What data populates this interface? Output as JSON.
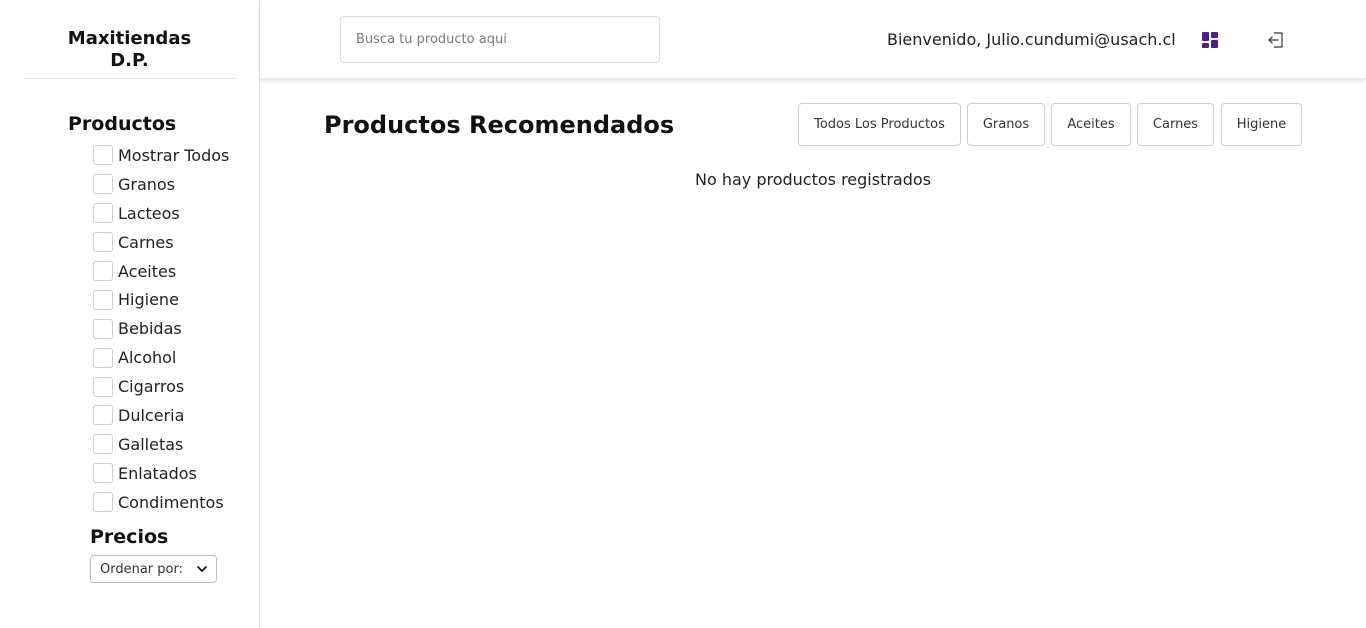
{
  "brand": {
    "line1": "Maxitiendas",
    "line2": "D.P."
  },
  "sidebar": {
    "categories_title": "Productos",
    "categories": [
      {
        "label": "Mostrar Todos",
        "checked": false
      },
      {
        "label": "Granos",
        "checked": false
      },
      {
        "label": "Lacteos",
        "checked": false
      },
      {
        "label": "Carnes",
        "checked": false
      },
      {
        "label": "Aceites",
        "checked": false
      },
      {
        "label": "Higiene",
        "checked": false
      },
      {
        "label": "Bebidas",
        "checked": false
      },
      {
        "label": "Alcohol",
        "checked": false
      },
      {
        "label": "Cigarros",
        "checked": false
      },
      {
        "label": "Dulceria",
        "checked": false
      },
      {
        "label": "Galletas",
        "checked": false
      },
      {
        "label": "Enlatados",
        "checked": false
      },
      {
        "label": "Condimentos",
        "checked": false
      }
    ],
    "prices_title": "Precios",
    "sort_selected": "Ordenar por:"
  },
  "header": {
    "search_placeholder": "Busca tu producto aqui",
    "welcome": "Bienvenido, Julio.cundumi@usach.cl",
    "dashboard_icon": "dashboard-icon",
    "logout_icon": "logout-icon"
  },
  "main": {
    "title": "Productos Recomendados",
    "filters": [
      {
        "label": "Todos Los Productos"
      },
      {
        "label": "Granos"
      },
      {
        "label": "Aceites"
      },
      {
        "label": "Carnes"
      },
      {
        "label": "Higiene"
      }
    ],
    "empty_message": "No hay productos registrados"
  },
  "colors": {
    "accent": "#4b1f8e"
  }
}
